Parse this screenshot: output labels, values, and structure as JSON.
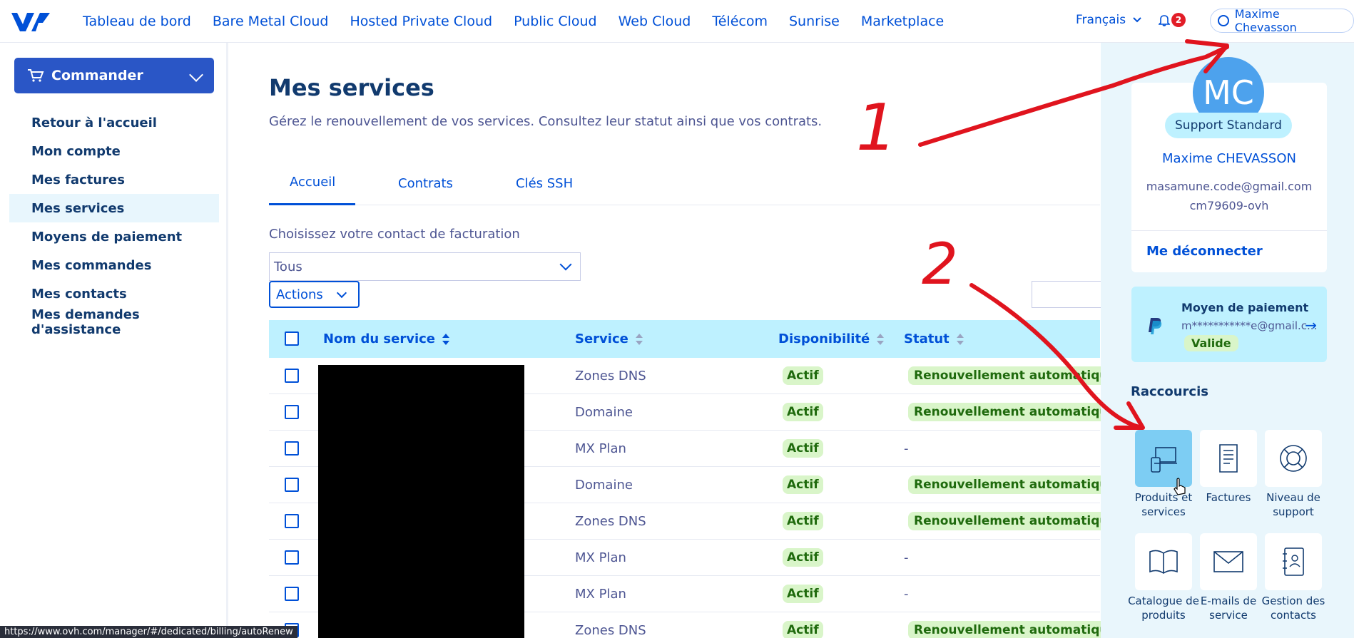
{
  "nav": {
    "links": [
      "Tableau de bord",
      "Bare Metal Cloud",
      "Hosted Private Cloud",
      "Public Cloud",
      "Web Cloud",
      "Télécom",
      "Sunrise",
      "Marketplace"
    ],
    "language": "Français",
    "notifications_count": "2",
    "user_name": "Maxime Chevasson"
  },
  "sidebar": {
    "order_label": "Commander",
    "items": [
      "Retour à l'accueil",
      "Mon compte",
      "Mes factures",
      "Mes services",
      "Moyens de paiement",
      "Mes commandes",
      "Mes contacts",
      "Mes demandes d'assistance"
    ],
    "active_index": 3
  },
  "main": {
    "title": "Mes services",
    "description": "Gérez le renouvellement de vos services. Consultez leur statut ainsi que vos contrats.",
    "tabs": [
      "Accueil",
      "Contrats",
      "Clés SSH"
    ],
    "contact_label": "Choisissez votre contact de facturation",
    "contact_value": "Tous",
    "actions_label": "Actions",
    "table": {
      "headers": [
        "Nom du service",
        "Service",
        "Disponibilité",
        "Statut"
      ],
      "rows": [
        {
          "service": "Zones DNS",
          "dispo": "Actif",
          "statut": "Renouvellement automatique"
        },
        {
          "service": "Domaine",
          "dispo": "Actif",
          "statut": "Renouvellement automatique"
        },
        {
          "service": "MX Plan",
          "dispo": "Actif",
          "statut": "-"
        },
        {
          "service": "Domaine",
          "dispo": "Actif",
          "statut": "Renouvellement automatique"
        },
        {
          "service": "Zones DNS",
          "dispo": "Actif",
          "statut": "Renouvellement automatique"
        },
        {
          "service": "MX Plan",
          "dispo": "Actif",
          "statut": "-"
        },
        {
          "service": "MX Plan",
          "dispo": "Actif",
          "statut": "-"
        },
        {
          "service": "Zones DNS",
          "dispo": "Actif",
          "statut": "Renouvellement automatique"
        }
      ]
    }
  },
  "panel": {
    "initials": "MC",
    "support_level": "Support Standard",
    "full_name": "Maxime CHEVASSON",
    "email": "masamune.code@gmail.com",
    "nic": "cm79609-ovh",
    "logout": "Me déconnecter",
    "payment_title": "Moyen de paiement",
    "payment_detail": "m***********e@gmail.c...",
    "payment_status": "Valide",
    "shortcuts_title": "Raccourcis",
    "shortcuts": [
      {
        "label": "Produits et services",
        "icon": "devices-icon"
      },
      {
        "label": "Factures",
        "icon": "invoice-icon"
      },
      {
        "label": "Niveau de support",
        "icon": "lifebuoy-icon"
      },
      {
        "label": "Catalogue de produits",
        "icon": "book-icon"
      },
      {
        "label": "E-mails de service",
        "icon": "mail-icon"
      },
      {
        "label": "Gestion des contacts",
        "icon": "contacts-icon"
      }
    ]
  },
  "statusbar": "https://www.ovh.com/manager/#/dedicated/billing/autoRenew",
  "annotations": [
    "1",
    "2"
  ],
  "colors": {
    "accent": "#0050d7",
    "header_bg": "#bef1ff",
    "success": "#d9f5c9"
  }
}
